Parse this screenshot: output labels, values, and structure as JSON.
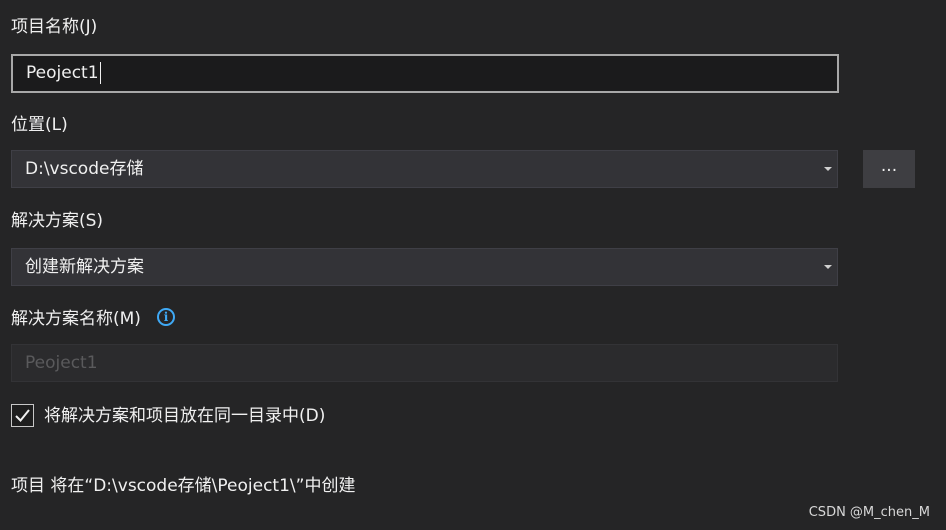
{
  "project_name": {
    "label": "项目名称(J)",
    "value": "Peoject1"
  },
  "location": {
    "label": "位置(L)",
    "value": "D:\\vscode存储",
    "browse_label": "..."
  },
  "solution": {
    "label": "解决方案(S)",
    "value": "创建新解决方案"
  },
  "solution_name": {
    "label": "解决方案名称(M)",
    "placeholder": "Peoject1",
    "info_glyph": "i"
  },
  "same_directory": {
    "label": "将解决方案和项目放在同一目录中(D)",
    "checked": true
  },
  "summary": {
    "text": "项目 将在“D:\\vscode存储\\Peoject1\\”中创建"
  },
  "watermark": "CSDN @M_chen_M",
  "colors": {
    "background": "#252526",
    "info_accent": "#3fa9f5",
    "textbox_border": "#a8a8a8"
  }
}
